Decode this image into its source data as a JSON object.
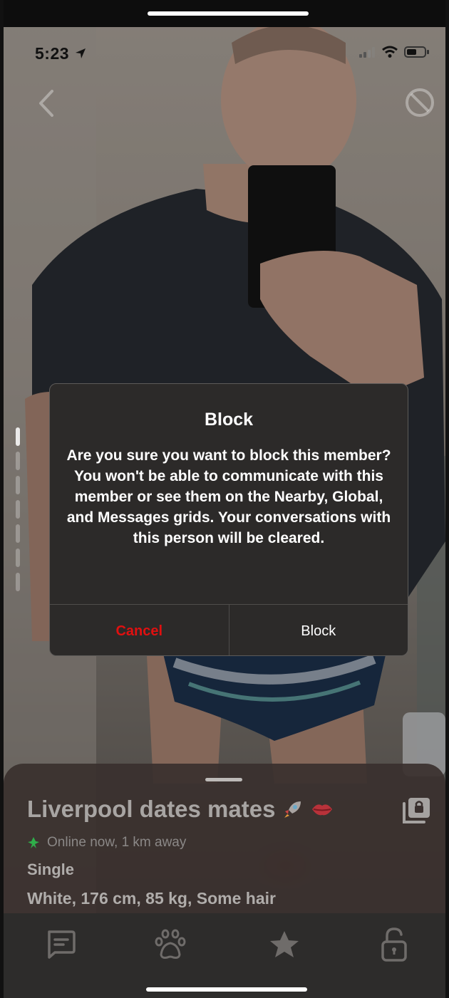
{
  "status_bar": {
    "time": "5:23"
  },
  "gallery": {
    "photo_count": 7,
    "active_index": 0
  },
  "dialog": {
    "title": "Block",
    "message": "Are you sure you want to block this member? You won't be able to communicate with this member or see them on the Nearby, Global, and Messages grids. Your conversations with this person will be cleared.",
    "cancel_label": "Cancel",
    "confirm_label": "Block"
  },
  "profile": {
    "name": "Liverpool dates mates",
    "name_emojis": [
      "rocket-emoji",
      "lips-emoji"
    ],
    "online_status": "Online now, 1 km away",
    "relationship": "Single",
    "stats": "White, 176 cm, 85 kg, Some hair"
  },
  "tab_bar": {
    "tabs": [
      "messages-icon",
      "paw-icon",
      "star-icon",
      "unlock-icon"
    ]
  },
  "colors": {
    "cancel": "#e01010",
    "online_dot": "#2fae4a",
    "dialog_bg": "#2c2a29"
  }
}
